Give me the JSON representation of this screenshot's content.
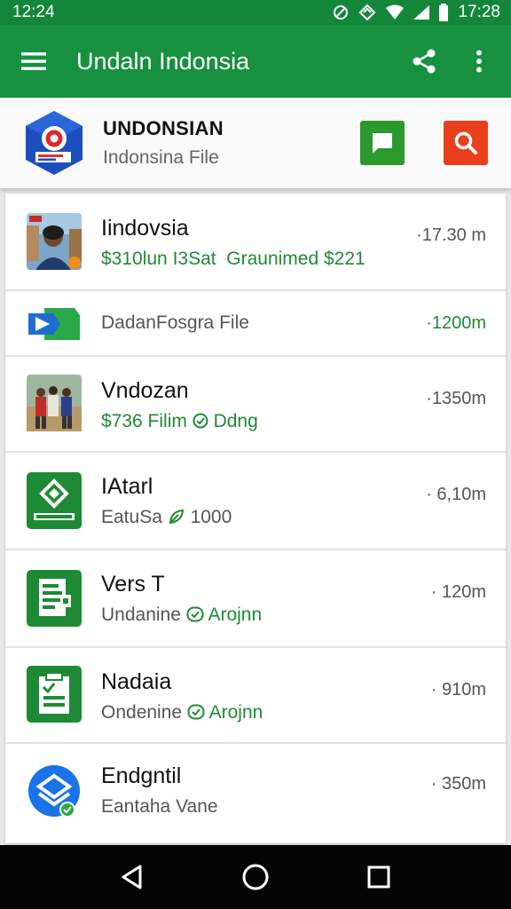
{
  "status_bar": {
    "time_left": "12:24",
    "time_right": "17:28"
  },
  "app_bar": {
    "title": "Undaln Indonsia"
  },
  "header": {
    "title": "UNDONSIAN",
    "subtitle": "Indonsina File"
  },
  "items": [
    {
      "name": "Iindovsia",
      "sub_primary": "$310lun I3Sat",
      "sub_secondary": "Graunimed $221",
      "time": "·17.30 m",
      "time_green": false,
      "icon": "photo-person-thumbnail"
    },
    {
      "name": "",
      "sub_primary": "DadanFosgra File",
      "sub_secondary": "",
      "time": "·1200m",
      "time_green": true,
      "icon": "drive-file-icon"
    },
    {
      "name": "Vndozan",
      "sub_primary": "$736 Filim",
      "sub_secondary": "Ddng",
      "time": "·1350m",
      "time_green": false,
      "icon": "photo-group-thumbnail"
    },
    {
      "name": "IAtarl",
      "sub_primary": "EatuSa",
      "sub_secondary": "1000",
      "time": "· 6,10m",
      "time_green": false,
      "icon": "green-diamond-app-icon"
    },
    {
      "name": "Vers T",
      "sub_primary": "Undanine",
      "sub_secondary": "Arojnn",
      "time": "· 120m",
      "time_green": false,
      "icon": "green-form-icon"
    },
    {
      "name": "Nadaia",
      "sub_primary": "Ondenine",
      "sub_secondary": "Arojnn",
      "time": "· 910m",
      "time_green": false,
      "icon": "green-clipboard-icon"
    },
    {
      "name": "Endgntil",
      "sub_primary": "Eantaha Vane",
      "sub_secondary": "",
      "time": "· 350m",
      "time_green": false,
      "icon": "blue-layers-icon"
    }
  ],
  "colors": {
    "app_bar": "#17903f",
    "accent_green": "#1f8a35",
    "search_red": "#e8401f"
  }
}
